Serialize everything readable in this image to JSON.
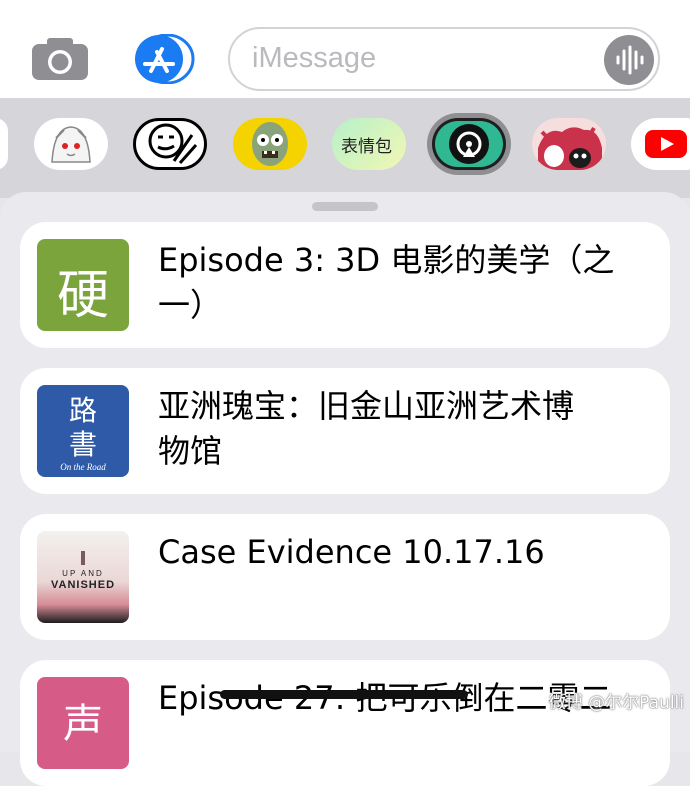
{
  "input": {
    "placeholder": "iMessage"
  },
  "drawer": {
    "apps": [
      "sticker-partial-icon",
      "ghost-sticker-icon",
      "stickman-sticker-icon",
      "zombie-sticker-icon",
      "biaoqingbao-app-icon",
      "podcast-share-app-icon",
      "monster-sticker-icon",
      "youtube-app-icon"
    ],
    "biaoqingbao_label": "表情包"
  },
  "episodes": [
    {
      "art_text": "硬",
      "title_line1": "Episode 3: 3D 电影的美学（之",
      "title_line2": "一）"
    },
    {
      "art_text_1": "路",
      "art_text_2": "書",
      "art_subtitle": "On the Road",
      "title_line1": "亚洲瑰宝：旧金山亚洲艺术博",
      "title_line2": "物馆"
    },
    {
      "art_text_1": "UP AND",
      "art_text_2": "VANISHED",
      "title_line1": "Case Evidence 10.17.16"
    },
    {
      "art_text": "声",
      "title_line1": "Episode 27: 把可乐倒在二零二"
    }
  ],
  "watermark": "微博 @尔尔Paulli",
  "colors": {
    "accent": "#1a7bf2",
    "card_bg": "#ffffff",
    "sheet_bg": "#e9e9ee"
  }
}
